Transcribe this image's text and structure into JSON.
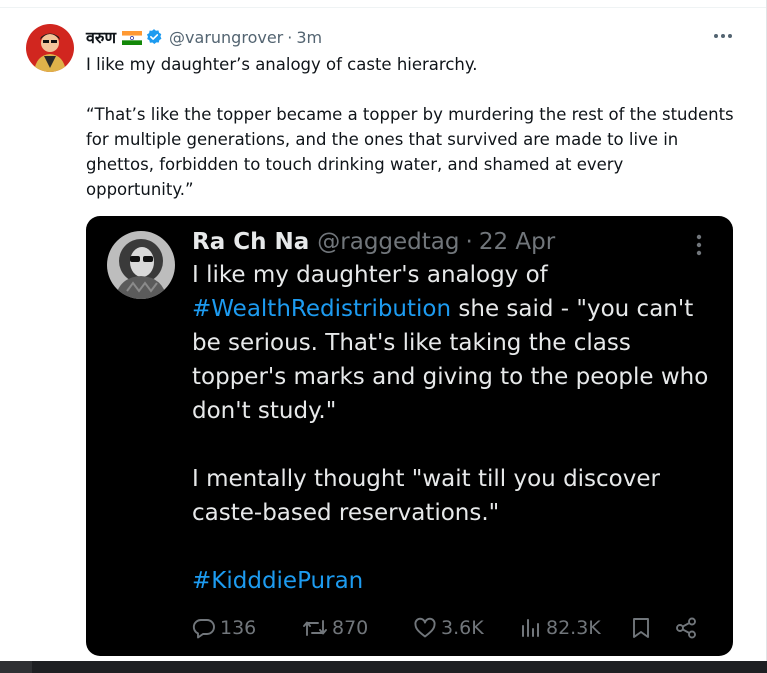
{
  "tweet": {
    "author_name": "वरुण",
    "handle": "@varungrover",
    "separator": "·",
    "time": "3m",
    "text_lines": [
      "I like my daughter’s analogy of caste hierarchy.",
      "“That’s like the topper became a topper by murdering the rest of the students for multiple generations, and the ones that survived are made to live in ghettos, forbidden to touch drinking water, and shamed at every opportunity.”"
    ],
    "icons": [
      "flag-india-icon",
      "verified-badge-icon",
      "more-options-icon"
    ]
  },
  "quoted_tweet": {
    "author_name": "Ra Ch Na",
    "handle": "@raggedtag",
    "separator": "·",
    "time": "22 Apr",
    "line1_before": "I like my daughter's analogy of",
    "hashtag1": "#WealthRedistribution",
    "line1_after": " she said - \"you can't be serious. That's like taking the class topper's marks and giving to the people who don't study.\"",
    "paragraph2": "I mentally thought \"wait till you discover caste-based reservations.\"",
    "hashtag2": "#KidddiePuran",
    "stats": {
      "replies": "136",
      "reposts": "870",
      "likes": "3.6K",
      "views": "82.3K"
    },
    "icons": [
      "reply-icon",
      "repost-icon",
      "like-icon",
      "views-icon",
      "bookmark-icon",
      "share-icon",
      "more-options-icon"
    ]
  },
  "colors": {
    "link": "#1d9bf0",
    "quote_background": "#000000",
    "muted": "#536471"
  }
}
